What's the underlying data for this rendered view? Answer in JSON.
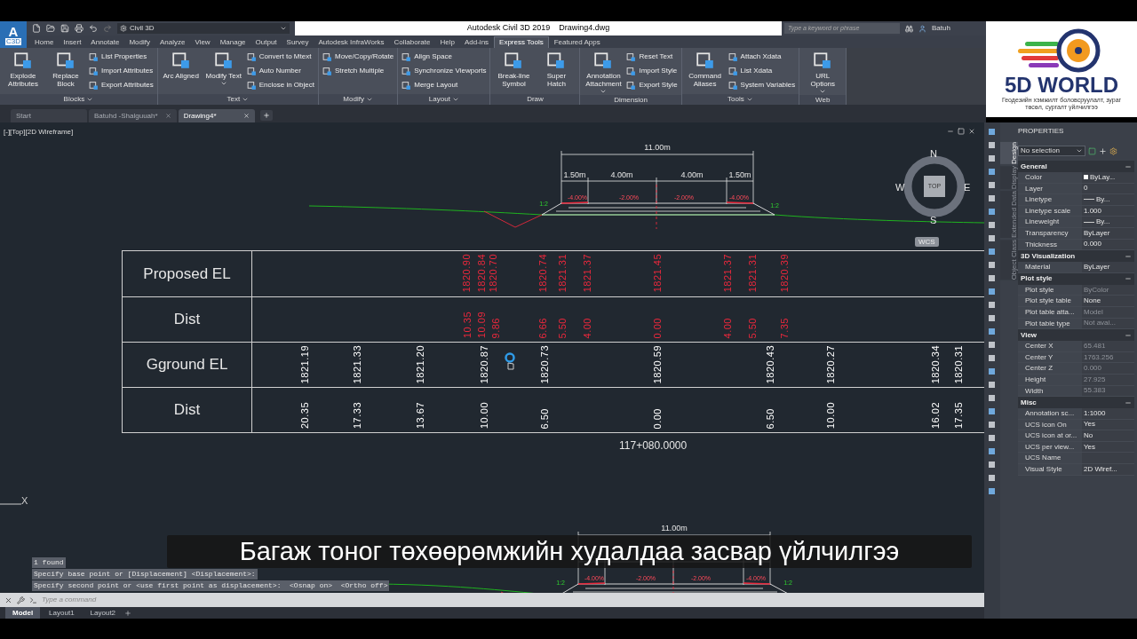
{
  "title_bar": {
    "app_letter": "A",
    "app_badge": "C3D",
    "workspace": "Civil 3D",
    "app_title": "Autodesk Civil 3D 2019",
    "file_name": "Drawing4.dwg",
    "search_placeholder": "Type a keyword or phrase",
    "user": "Batuh"
  },
  "ribbon": {
    "tabs": [
      {
        "label": "Home",
        "selected": false
      },
      {
        "label": "Insert",
        "selected": false
      },
      {
        "label": "Annotate",
        "selected": false
      },
      {
        "label": "Modify",
        "selected": false
      },
      {
        "label": "Analyze",
        "selected": false
      },
      {
        "label": "View",
        "selected": false
      },
      {
        "label": "Manage",
        "selected": false
      },
      {
        "label": "Output",
        "selected": false
      },
      {
        "label": "Survey",
        "selected": false
      },
      {
        "label": "Autodesk InfraWorks",
        "selected": false
      },
      {
        "label": "Collaborate",
        "selected": false
      },
      {
        "label": "Help",
        "selected": false
      },
      {
        "label": "Add-ins",
        "selected": false
      },
      {
        "label": "Express Tools",
        "selected": true
      },
      {
        "label": "Featured Apps",
        "selected": false
      }
    ],
    "panels": [
      {
        "title": "Blocks",
        "has_menu": true,
        "large": [
          {
            "label": "Explode Attributes",
            "has_menu": false
          },
          {
            "label": "Replace Block",
            "has_menu": false
          }
        ],
        "small": [
          "List Properties",
          "Import Attributes",
          "Export Attributes"
        ]
      },
      {
        "title": "Text",
        "has_menu": true,
        "large": [
          {
            "label": "Arc Aligned",
            "has_menu": false
          },
          {
            "label": "Modify Text",
            "has_menu": true
          }
        ],
        "small": [
          "Convert to Mtext",
          "Auto Number",
          "Enclose in Object"
        ]
      },
      {
        "title": "Modify",
        "has_menu": true,
        "small": [
          "Move/Copy/Rotate",
          "Stretch Multiple"
        ]
      },
      {
        "title": "Layout",
        "has_menu": true,
        "small": [
          "Align Space",
          "Synchronize Viewports",
          "Merge Layout"
        ]
      },
      {
        "title": "Draw",
        "has_menu": false,
        "large": [
          {
            "label": "Break-line Symbol",
            "has_menu": false
          },
          {
            "label": "Super Hatch",
            "has_menu": false
          }
        ]
      },
      {
        "title": "Dimension",
        "has_menu": false,
        "large": [
          {
            "label": "Annotation Attachment",
            "has_menu": true
          }
        ],
        "small": [
          "Reset Text",
          "Import Style",
          "Export Style"
        ]
      },
      {
        "title": "Tools",
        "has_menu": true,
        "large": [
          {
            "label": "Command Aliases",
            "has_menu": false
          }
        ],
        "small": [
          "Attach Xdata",
          "List Xdata",
          "System Variables"
        ]
      },
      {
        "title": "Web",
        "has_menu": false,
        "large": [
          {
            "label": "URL Options",
            "has_menu": true
          }
        ]
      }
    ]
  },
  "file_tabs": [
    {
      "label": "Start",
      "selected": false,
      "closable": false
    },
    {
      "label": "Batuhd -Shalguuah*",
      "selected": false,
      "closable": true
    },
    {
      "label": "Drawing4*",
      "selected": true,
      "closable": true
    }
  ],
  "viewport": {
    "label": "[-][Top][2D Wireframe]",
    "section_top": {
      "total_width": "11.00m",
      "widths": [
        "1.50m",
        "4.00m",
        "4.00m",
        "1.50m"
      ],
      "slopes": [
        "-4.00%",
        "-2.00%",
        "-2.00%",
        "-4.00%"
      ],
      "side_slopes": [
        "1:2",
        "1:2"
      ]
    },
    "table": {
      "rows": [
        {
          "label": "Proposed EL",
          "color": "#e8283c",
          "values": [
            "1820.90",
            "1820.84",
            "1820.70",
            "1820.74",
            "1821.31",
            "1821.37",
            "1821.45",
            "1821.37",
            "1821.31",
            "1820.39"
          ]
        },
        {
          "label": "Dist",
          "color": "#e8283c",
          "values": [
            "10.35",
            "10.09",
            "9.86",
            "6.66",
            "5.50",
            "4.00",
            "0.00",
            "4.00",
            "5.50",
            "7.35"
          ]
        },
        {
          "label": "Gground EL",
          "color": "#ffffff",
          "values": [
            "1821.19",
            "1821.33",
            "1821.20",
            "1820.87",
            "1820.73",
            "1820.59",
            "1820.43",
            "1820.27",
            "1820.34",
            "1820.31"
          ]
        },
        {
          "label": "Dist",
          "color": "#ffffff",
          "values": [
            "20.35",
            "17.33",
            "13.67",
            "10.00",
            "6.50",
            "0.00",
            "6.50",
            "10.00",
            "16.02",
            "17.35"
          ]
        }
      ]
    },
    "station": "117+080.0000",
    "section_bottom": {
      "total_width": "11.00m",
      "slopes": [
        "-4.00%",
        "-2.00%",
        "-2.00%",
        "-4.00%"
      ],
      "side_slopes": [
        "1:2",
        "1:2"
      ]
    },
    "compass": {
      "n": "N",
      "s": "S",
      "e": "E",
      "w": "W",
      "top": "TOP",
      "wcs": "WCS"
    },
    "ucs_axis": "X"
  },
  "command_history": [
    "1 found",
    "Specify base point or [Displacement] <Displacement>:",
    "Specify second point or <use first point as displacement>:  <Osnap on>  <Ortho off>"
  ],
  "subtitle": "Багаж тоног төхөөрөмжийн худалдаа засвар үйлчилгээ",
  "command_line": {
    "placeholder": "Type a command"
  },
  "layout_tabs": [
    {
      "label": "Model",
      "selected": true
    },
    {
      "label": "Layout1",
      "selected": false
    },
    {
      "label": "Layout2",
      "selected": false
    }
  ],
  "properties": {
    "title": "PROPERTIES",
    "selection": "No selection",
    "side_tabs": [
      {
        "label": "Design",
        "selected": true
      },
      {
        "label": "Display",
        "selected": false
      },
      {
        "label": "Extended Data",
        "selected": false
      },
      {
        "label": "Object Class",
        "selected": false
      }
    ],
    "sections": [
      {
        "title": "General",
        "expanded": true,
        "rows": [
          {
            "label": "Color",
            "value": "ByLay...",
            "kind": "color",
            "disabled": false
          },
          {
            "label": "Layer",
            "value": "0",
            "kind": "text",
            "disabled": false
          },
          {
            "label": "Linetype",
            "value": "By...",
            "kind": "line",
            "disabled": false
          },
          {
            "label": "Linetype scale",
            "value": "1.000",
            "kind": "text",
            "disabled": false
          },
          {
            "label": "Lineweight",
            "value": "By...",
            "kind": "line",
            "disabled": false
          },
          {
            "label": "Transparency",
            "value": "ByLayer",
            "kind": "text",
            "disabled": false
          },
          {
            "label": "Thickness",
            "value": "0.000",
            "kind": "text",
            "disabled": false
          }
        ]
      },
      {
        "title": "3D Visualization",
        "expanded": true,
        "rows": [
          {
            "label": "Material",
            "value": "ByLayer",
            "kind": "text",
            "disabled": false
          }
        ]
      },
      {
        "title": "Plot style",
        "expanded": true,
        "rows": [
          {
            "label": "Plot style",
            "value": "ByColor",
            "kind": "text",
            "disabled": true
          },
          {
            "label": "Plot style table",
            "value": "None",
            "kind": "text",
            "disabled": false
          },
          {
            "label": "Plot table atta...",
            "value": "Model",
            "kind": "text",
            "disabled": true
          },
          {
            "label": "Plot table type",
            "value": "Not avai...",
            "kind": "text",
            "disabled": true
          }
        ]
      },
      {
        "title": "View",
        "expanded": true,
        "rows": [
          {
            "label": "Center X",
            "value": "65.481",
            "kind": "text",
            "disabled": true
          },
          {
            "label": "Center Y",
            "value": "1763.256",
            "kind": "text",
            "disabled": true
          },
          {
            "label": "Center Z",
            "value": "0.000",
            "kind": "text",
            "disabled": true
          },
          {
            "label": "Height",
            "value": "27.925",
            "kind": "text",
            "disabled": true
          },
          {
            "label": "Width",
            "value": "55.383",
            "kind": "text",
            "disabled": true
          }
        ]
      },
      {
        "title": "Misc",
        "expanded": true,
        "rows": [
          {
            "label": "Annotation sc...",
            "value": "1:1000",
            "kind": "text",
            "disabled": false
          },
          {
            "label": "UCS icon On",
            "value": "Yes",
            "kind": "text",
            "disabled": false
          },
          {
            "label": "UCS icon at or...",
            "value": "No",
            "kind": "text",
            "disabled": false
          },
          {
            "label": "UCS per view...",
            "value": "Yes",
            "kind": "text",
            "disabled": false
          },
          {
            "label": "UCS Name",
            "kind": "text",
            "disabled": false
          },
          {
            "label": "Visual Style",
            "value": "2D Wiref...",
            "kind": "text",
            "disabled": false
          }
        ]
      }
    ]
  },
  "logo": {
    "name": "5D WORLD",
    "tagline": "Геодезийн хэмжилт боловсруулалт, зураг төсөл, сургалт үйлчилгээ"
  }
}
